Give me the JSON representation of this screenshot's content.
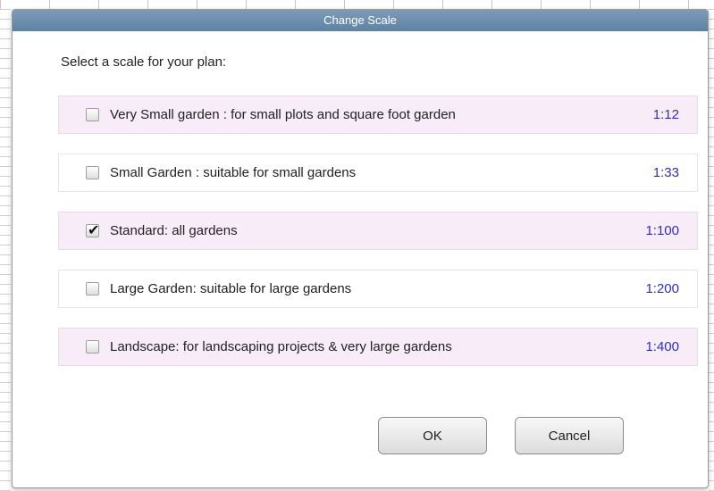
{
  "dialog": {
    "title": "Change Scale",
    "prompt": "Select a scale for your plan:",
    "options": [
      {
        "label": "Very Small garden : for small plots and square foot garden",
        "scale": "1:12",
        "checked": false
      },
      {
        "label": "Small Garden : suitable for small gardens",
        "scale": "1:33",
        "checked": false
      },
      {
        "label": "Standard: all gardens",
        "scale": "1:100",
        "checked": true
      },
      {
        "label": "Large Garden: suitable for large gardens",
        "scale": "1:200",
        "checked": false
      },
      {
        "label": "Landscape: for landscaping projects & very large gardens",
        "scale": "1:400",
        "checked": false
      }
    ],
    "ok_label": "OK",
    "cancel_label": "Cancel",
    "check_glyph": "✔"
  },
  "colors": {
    "titlebar": "#6a8cab",
    "scale_text": "#3030b0",
    "option_highlight": "#f7ecf7"
  },
  "icons": {
    "checkbox": "checkbox-icon",
    "checkmark": "checkmark-icon"
  }
}
